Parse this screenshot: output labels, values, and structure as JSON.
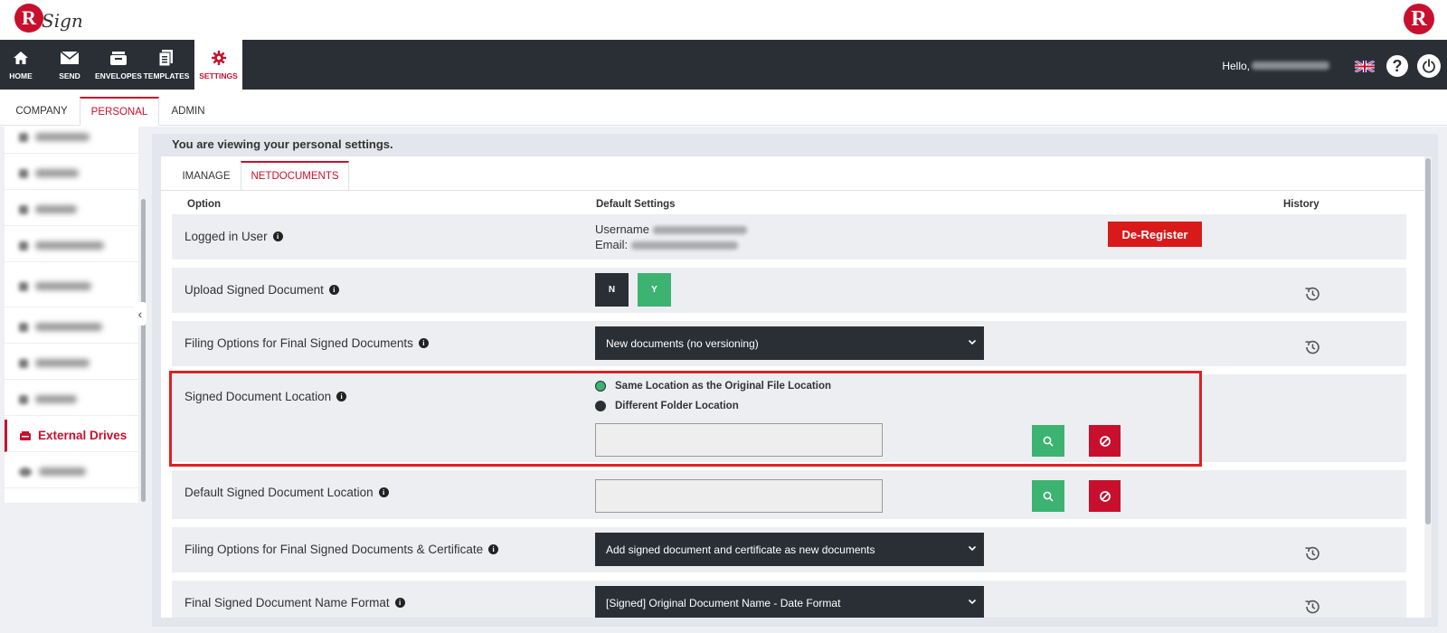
{
  "brand": {
    "logo_letter": "R",
    "logo_word": "Sign",
    "right_logo_letter": "R"
  },
  "nav": {
    "items": [
      {
        "label": "HOME",
        "icon": "home-icon"
      },
      {
        "label": "SEND",
        "icon": "envelope-icon"
      },
      {
        "label": "ENVELOPES",
        "icon": "inbox-icon"
      },
      {
        "label": "TEMPLATES",
        "icon": "templates-icon"
      },
      {
        "label": "SETTINGS",
        "icon": "gear-icon"
      }
    ],
    "active": "SETTINGS",
    "hello": "Hello,",
    "help_glyph": "?"
  },
  "settings_tabs": [
    "COMPANY",
    "PERSONAL",
    "ADMIN"
  ],
  "settings_active_tab": "PERSONAL",
  "sidebar": {
    "active_item": "External Drives",
    "toggle_glyph": "‹"
  },
  "main": {
    "notice": "You are viewing your personal settings.",
    "tabs": [
      "IMANAGE",
      "NETDOCUMENTS"
    ],
    "active_tab": "NETDOCUMENTS",
    "columns": {
      "option": "Option",
      "default": "Default Settings",
      "history": "History"
    },
    "rows": {
      "logged_in": {
        "label": "Logged in User",
        "username_label": "Username",
        "email_label": "Email:",
        "deregister": "De-Register"
      },
      "upload": {
        "label": "Upload Signed Document",
        "no": "N",
        "yes": "Y",
        "selected": "Y"
      },
      "filing": {
        "label": "Filing Options for Final Signed Documents",
        "value": "New documents (no versioning)"
      },
      "location": {
        "label": "Signed Document Location",
        "option_same": "Same Location as the Original File Location",
        "option_different": "Different Folder Location",
        "selected": "Same Location as the Original File Location",
        "path_value": ""
      },
      "default_location": {
        "label": "Default Signed Document Location",
        "path_value": ""
      },
      "filing_cert": {
        "label": "Filing Options for Final Signed Documents & Certificate",
        "value": "Add signed document and certificate as new documents"
      },
      "name_format": {
        "label": "Final Signed Document Name Format",
        "value": "[Signed] Original Document Name - Date Format"
      }
    }
  },
  "colors": {
    "accent": "#c8102e",
    "nav_bg": "#2a2f36",
    "green": "#3cb371",
    "highlight": "#e02020"
  }
}
